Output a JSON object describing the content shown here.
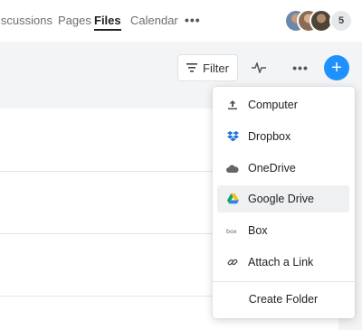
{
  "nav": {
    "tabs": [
      {
        "label": "iscussions"
      },
      {
        "label": "Pages"
      },
      {
        "label": "Files",
        "active": true
      },
      {
        "label": "Calendar"
      }
    ],
    "more_label": "•••",
    "avatars_extra_count": "5"
  },
  "toolbar": {
    "filter_label": "Filter",
    "more_label": "•••",
    "add_label": "+"
  },
  "menu": {
    "items": [
      {
        "label": "Computer",
        "icon": "upload-icon"
      },
      {
        "label": "Dropbox",
        "icon": "dropbox-icon"
      },
      {
        "label": "OneDrive",
        "icon": "onedrive-icon"
      },
      {
        "label": "Google Drive",
        "icon": "google-drive-icon",
        "highlighted": true
      },
      {
        "label": "Box",
        "icon": "box-icon"
      },
      {
        "label": "Attach a Link",
        "icon": "link-icon"
      }
    ],
    "create_folder_label": "Create Folder"
  },
  "colors": {
    "accent": "#1e90ff",
    "band": "#f3f4f6",
    "hover": "#eef0f2"
  }
}
